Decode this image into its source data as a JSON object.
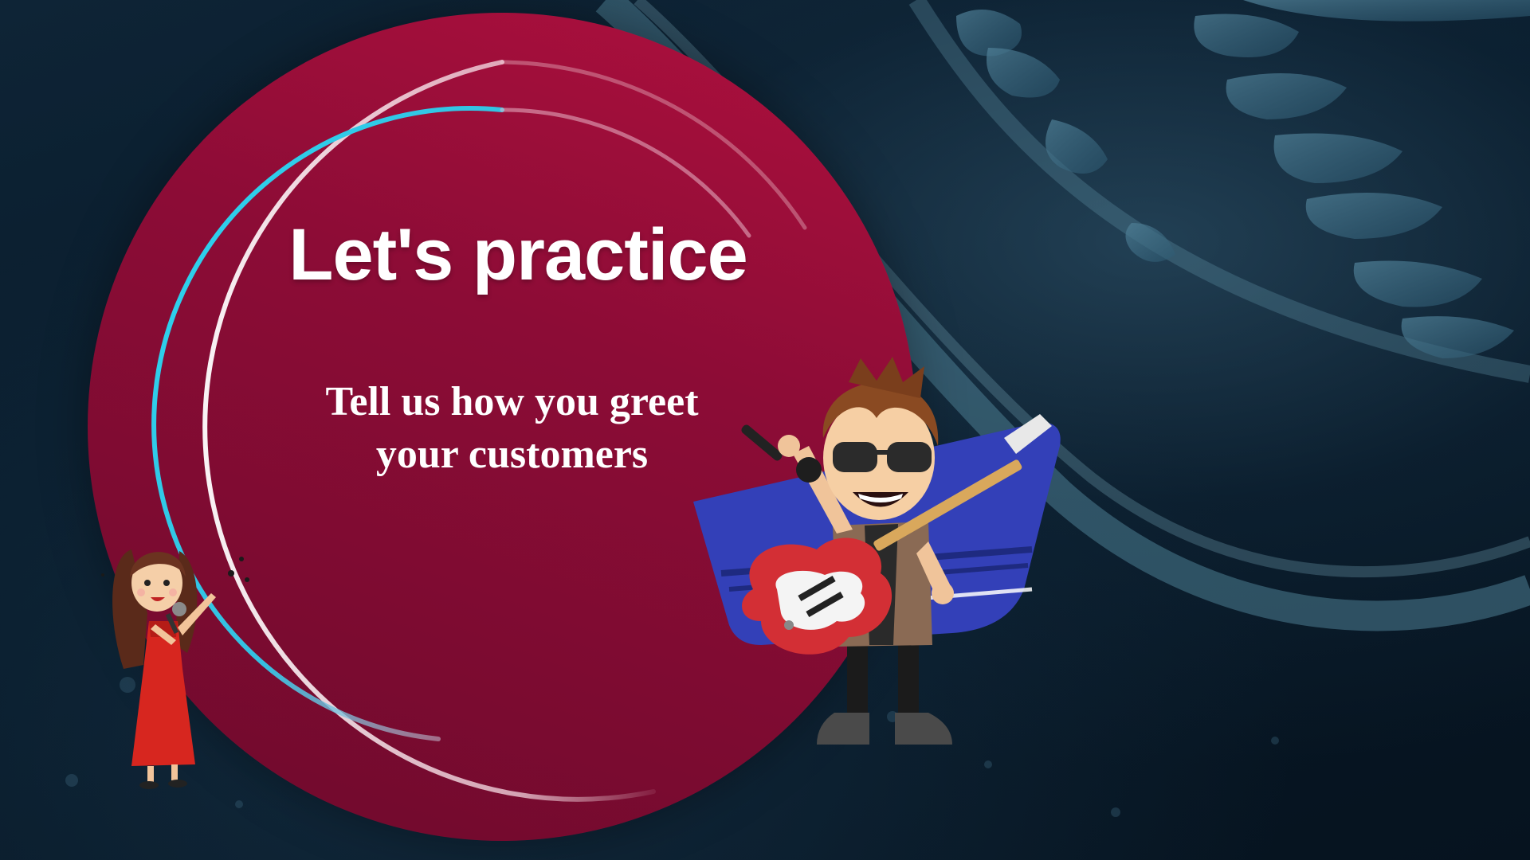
{
  "slide": {
    "title": "Let's practice",
    "subtitle_line1": "Tell us how you greet",
    "subtitle_line2": "your customers"
  },
  "colors": {
    "background": "#0a1b2a",
    "circle": "#9c0e3a",
    "ring_cyan": "#22c8e6",
    "ring_white": "#f3e6ea",
    "text": "#ffffff",
    "banner_blue": "#3a45c0"
  },
  "illustrations": {
    "left": "female-singer-illustration",
    "right": "guitarist-singer-illustration",
    "background": "sneaker-sole-photo"
  }
}
